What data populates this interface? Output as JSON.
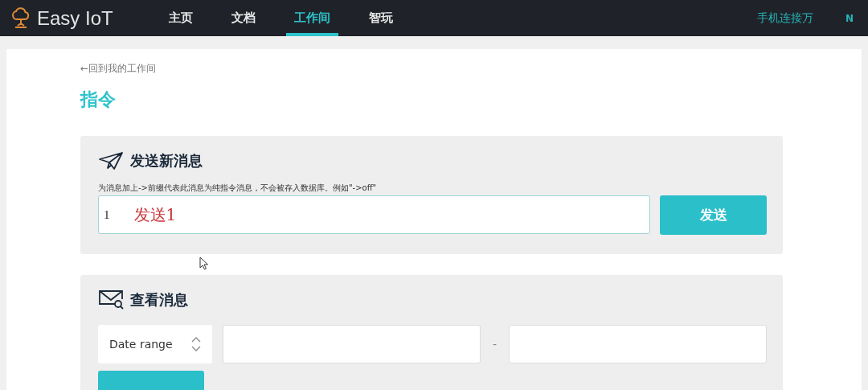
{
  "navbar": {
    "logo": "Easy IoT",
    "items": [
      {
        "label": "主页",
        "selected": false
      },
      {
        "label": "文档",
        "selected": false
      },
      {
        "label": "工作间",
        "selected": true
      },
      {
        "label": "智玩",
        "selected": false
      }
    ],
    "user": "手机连接万",
    "user_extra": "N"
  },
  "back_link": "←回到我的工作间",
  "page_title": "指令",
  "send_card": {
    "title": "发送新消息",
    "hint": "为消息加上->前缀代表此消息为纯指令消息，不会被存入数据库。例如\"->off\"",
    "input_value": "1",
    "annotation": "发送1",
    "button": "发送"
  },
  "view_card": {
    "title": "查看消息",
    "select": "Date range",
    "separator": "-"
  }
}
